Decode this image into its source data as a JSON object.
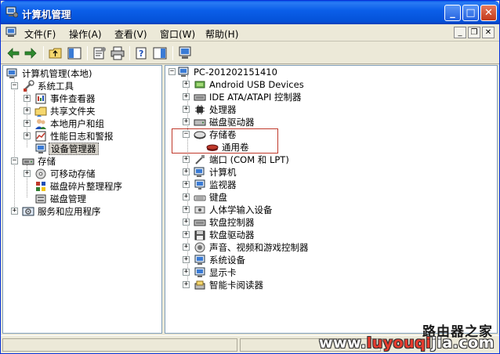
{
  "window": {
    "title": "计算机管理"
  },
  "menu": {
    "items": [
      "文件(F)",
      "操作(A)",
      "查看(V)",
      "窗口(W)",
      "帮助(H)"
    ]
  },
  "left_tree": {
    "root": "计算机管理(本地)",
    "system_tools": "系统工具",
    "event_viewer": "事件查看器",
    "shared_folders": "共享文件夹",
    "local_users": "本地用户和组",
    "perf_logs": "性能日志和警报",
    "device_manager": "设备管理器",
    "storage": "存储",
    "removable_storage": "可移动存储",
    "defrag": "磁盘碎片整理程序",
    "disk_management": "磁盘管理",
    "services_apps": "服务和应用程序"
  },
  "right_tree": {
    "computer_name": "PC-201202151410",
    "devices": [
      "Android USB Devices",
      "IDE ATA/ATAPI 控制器",
      "处理器",
      "磁盘驱动器",
      "存储卷",
      "通用卷",
      "端口 (COM 和 LPT)",
      "计算机",
      "监视器",
      "键盘",
      "人体学输入设备",
      "软盘控制器",
      "软盘驱动器",
      "声音、视频和游戏控制器",
      "系统设备",
      "显示卡",
      "智能卡阅读器"
    ]
  },
  "watermark": {
    "top": "路由器之家",
    "bottom_left": "www.",
    "bottom_red": "luyouqi",
    "bottom_right": "jia.com"
  },
  "colors": {
    "titlebar": "#0b5fe9",
    "highlight_box": "#c0392b",
    "selection": "#d4d0c8"
  }
}
